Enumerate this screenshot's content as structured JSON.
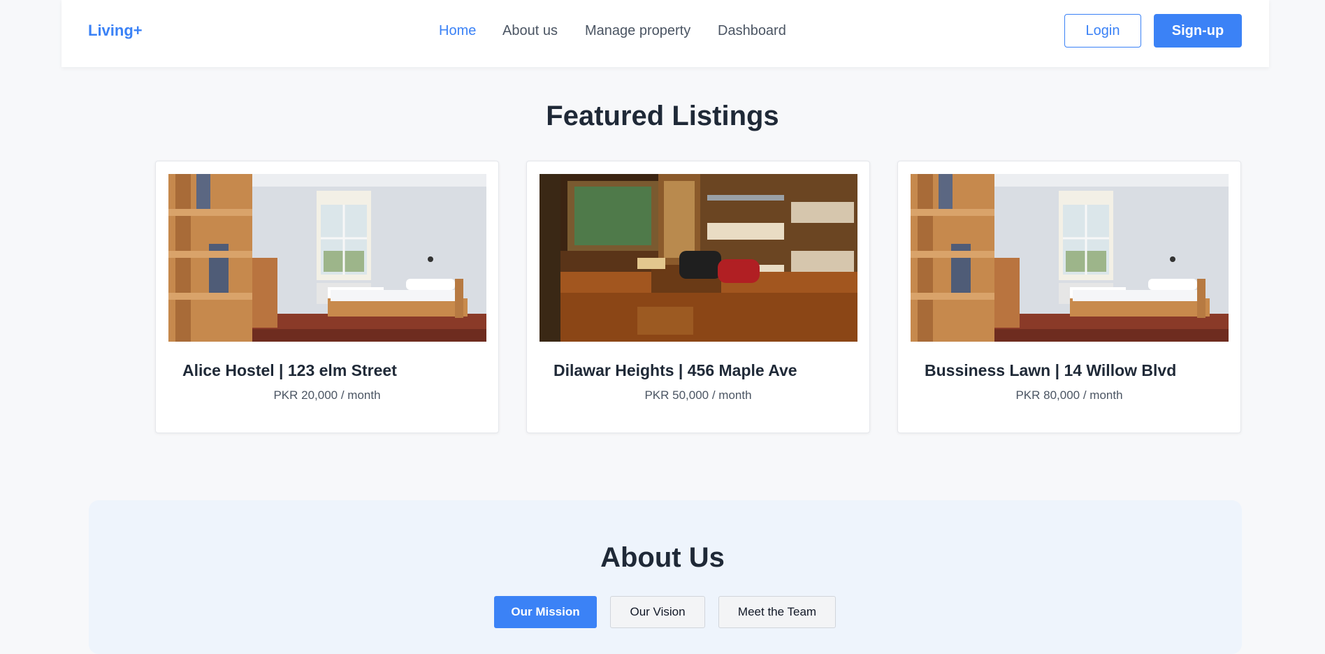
{
  "navbar": {
    "brand": "Living+",
    "links": [
      {
        "label": "Home",
        "active": true
      },
      {
        "label": "About us",
        "active": false
      },
      {
        "label": "Manage property",
        "active": false
      },
      {
        "label": "Dashboard",
        "active": false
      }
    ],
    "login_label": "Login",
    "signup_label": "Sign-up"
  },
  "featured": {
    "title": "Featured Listings",
    "listings": [
      {
        "name": "Alice Hostel | 123 elm Street",
        "price": "PKR 20,000 / month",
        "image": "bright-bunk-room-photo"
      },
      {
        "name": "Dilawar Heights | 456 Maple Ave",
        "price": "PKR 50,000 / month",
        "image": "dorm-room-with-luggage-photo"
      },
      {
        "name": "Bussiness Lawn | 14 Willow Blvd",
        "price": "PKR 80,000 / month",
        "image": "bright-bunk-room-photo"
      }
    ]
  },
  "about": {
    "title": "About Us",
    "tabs": [
      {
        "label": "Our Mission",
        "active": true
      },
      {
        "label": "Our Vision",
        "active": false
      },
      {
        "label": "Meet the Team",
        "active": false
      }
    ]
  },
  "colors": {
    "accent": "#3b82f6",
    "page_bg": "#f7f8fa",
    "about_bg": "#eef4fc"
  }
}
